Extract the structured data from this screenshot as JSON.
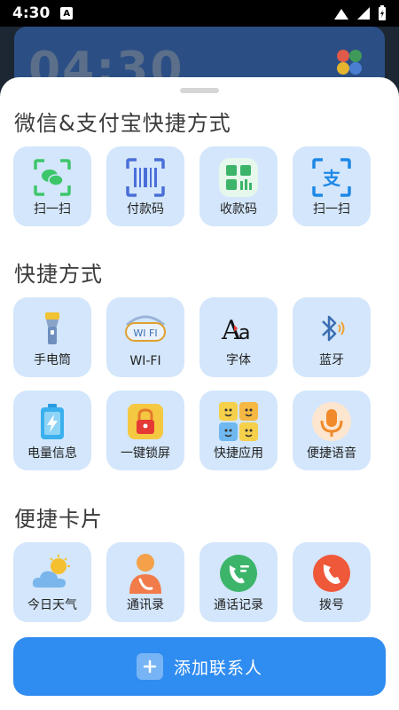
{
  "status": {
    "time": "4:30",
    "indicator": "A"
  },
  "background": {
    "clock": "04:30"
  },
  "sections": {
    "wechat_alipay": {
      "title": "微信&支付宝快捷方式",
      "items": [
        {
          "label": "扫一扫",
          "icon": "wechat-scan-icon"
        },
        {
          "label": "付款码",
          "icon": "barcode-icon"
        },
        {
          "label": "收款码",
          "icon": "qrcode-receive-icon"
        },
        {
          "label": "扫一扫",
          "icon": "alipay-scan-icon"
        }
      ]
    },
    "shortcuts": {
      "title": "快捷方式",
      "items": [
        {
          "label": "手电筒",
          "icon": "flashlight-icon"
        },
        {
          "label": "WI-FI",
          "icon": "wifi-icon"
        },
        {
          "label": "字体",
          "icon": "font-icon"
        },
        {
          "label": "蓝牙",
          "icon": "bluetooth-icon"
        },
        {
          "label": "电量信息",
          "icon": "battery-icon"
        },
        {
          "label": "一键锁屏",
          "icon": "lock-icon"
        },
        {
          "label": "快捷应用",
          "icon": "app-puzzle-icon"
        },
        {
          "label": "便捷语音",
          "icon": "microphone-icon"
        }
      ]
    },
    "cards": {
      "title": "便捷卡片",
      "items": [
        {
          "label": "今日天气",
          "icon": "weather-icon"
        },
        {
          "label": "通讯录",
          "icon": "contacts-icon"
        },
        {
          "label": "通话记录",
          "icon": "call-log-icon"
        },
        {
          "label": "拨号",
          "icon": "dial-icon"
        }
      ]
    }
  },
  "add_contact": {
    "label": "添加联系人"
  },
  "colors": {
    "tile": "#d3e6fb",
    "accent": "#2f8cf0",
    "wechat": "#3cc66a",
    "alipay": "#1e88e5"
  }
}
